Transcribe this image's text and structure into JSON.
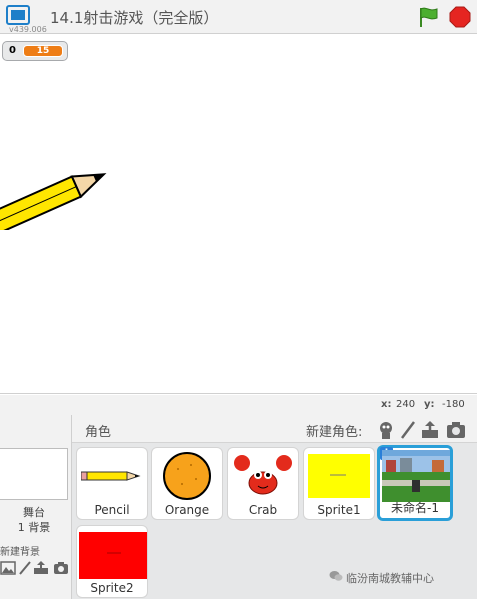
{
  "titlebar": {
    "project_title": "14.1射击游戏（完全版）",
    "version": "v439.006",
    "fullscreen_icon": "fullscreen-icon",
    "green_flag_icon": "green-flag-icon",
    "stop_icon": "stop-sign-icon"
  },
  "stage": {
    "variable_monitor": {
      "name": "0",
      "value": "15"
    },
    "sprite_on_stage": "pencil"
  },
  "coords": {
    "x_label": "x:",
    "x_value": "240",
    "y_label": "y:",
    "y_value": "-180"
  },
  "stage_panel": {
    "label": "舞台",
    "backdrop_count": "1 背景",
    "new_backdrop_label": "新建背景"
  },
  "sprites": {
    "title": "角色",
    "new_sprite_label": "新建角色:",
    "items": [
      {
        "name": "Pencil"
      },
      {
        "name": "Orange"
      },
      {
        "name": "Crab"
      },
      {
        "name": "Sprite1"
      },
      {
        "name": "未命名-1",
        "selected": true
      }
    ],
    "row2": [
      {
        "name": "Sprite2"
      }
    ]
  },
  "watermark": "临汾南城教辅中心",
  "colors": {
    "accent": "#2a9fd8",
    "orange": "#ee7d16",
    "stop": "#e52521",
    "flag": "#4caf2f"
  }
}
